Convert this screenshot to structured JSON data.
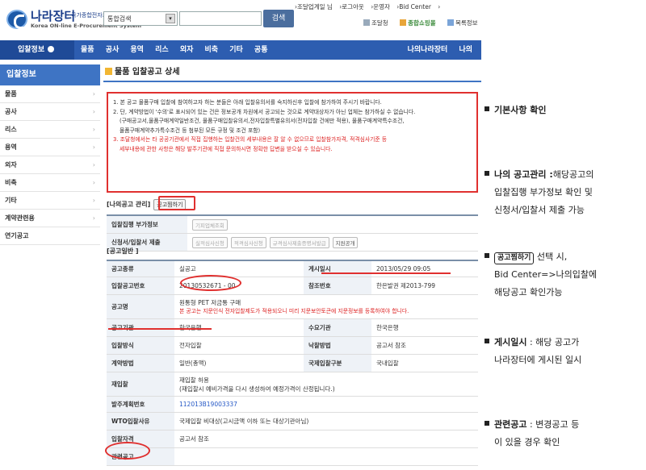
{
  "header": {
    "logo_name": "나라장터",
    "logo_sub": "국가종합전자조달",
    "logo_eng": "Korea ON-line E-Procurement System",
    "search_select": "통합검색",
    "search_button": "검색",
    "top_links": [
      "›조달업계일 님",
      "›로그아웃",
      "›운영자",
      "›Bid Center",
      "›"
    ],
    "sub_links": [
      "조달청",
      "종합쇼핑몰",
      "목록정보"
    ]
  },
  "nav": {
    "lead": "입찰정보",
    "items": [
      "물품",
      "공사",
      "용역",
      "리스",
      "외자",
      "비축",
      "기타",
      "공통"
    ],
    "right": [
      "나의나라장터",
      "나의"
    ]
  },
  "sidebar": {
    "title": "입찰정보",
    "items": [
      "물품",
      "공사",
      "리스",
      "용역",
      "외자",
      "비축",
      "기타",
      "계약관련용",
      "연기공고"
    ]
  },
  "page": {
    "title": "물품 입찰공고 상세",
    "notice": [
      "1. 본 공고 물품구매 입찰에 참여하고자 하는 분들은 아래 입찰유의서를 숙지하신후 입찰에 참가하여 주시기 바랍니다.",
      "2. 단, 계약방법이 '수의'로 표시되어 있는 건은 정보공개 차원에서 공고되는 것으로 계약대상자가 아닌 업체는 참가하실 수 없습니다.",
      "(구매공고서,물품구매계약일반조건, 물품구매입찰유의서,전자입찰특별유의서(전자입찰 건에만 적용), 물품구매계약특수조건,",
      "물품구매계약추가특수조건 등 첨부된 모든 규정 및 조건 포함)",
      "3. 조달청에서는 타 공공기관에서 직접 집행하는 입찰건의 세부내용은 잘 알 수 없으므로 입찰참가자격, 적격심사기준 등",
      "세부내용에 관한 사항은 해당 발주기관에 직접 문의하시면 정확한 답변을 받으실 수 있습니다."
    ],
    "my_section": {
      "title": "[나의공고 관리]",
      "bookmark_button": "공고찜하기",
      "rows": [
        {
          "label": "입찰집행 부가정보",
          "buttons": [
            "기피업체조회"
          ]
        },
        {
          "label": "신청서/입찰서 제출",
          "buttons": [
            "실적심사신청",
            "적격심사신청",
            "규격심사제출증명서발급",
            "지원공개"
          ]
        }
      ]
    },
    "general_section": {
      "title": "[공고일반 ]",
      "rows": [
        {
          "l1": "공고종류",
          "v1": "실공고",
          "l2": "게시일시",
          "v2": "2013/05/29 09:05"
        },
        {
          "l1": "입찰공고번호",
          "v1": "20130532671 - 00",
          "l2": "참조번호",
          "v2": "한은발권 제2013-799"
        },
        {
          "l1": "공고명",
          "v1": "원통형 PET 저금통 구매",
          "v1b": "본 공고는 지문인식 전자입찰제도가 적용되오니 미리 지문보안토큰에 지문정보를 등록하여야 합니다."
        },
        {
          "l1": "공고기관",
          "v1": "한국은행",
          "l2": "수요기관",
          "v2": "한국은행"
        },
        {
          "l1": "입찰방식",
          "v1": "전자입찰",
          "l2": "낙찰방법",
          "v2": "공고서 참조"
        },
        {
          "l1": "계약방법",
          "v1": "일반(총액)",
          "l2": "국제입찰구분",
          "v2": "국내입찰"
        },
        {
          "l1": "재입찰",
          "v1": "재입찰 허용",
          "v1b": "(재입찰시 예비가격을 다시 생성하여 예정가격이 산정됩니다.)"
        },
        {
          "l1": "발주계획번호",
          "v1": "112013B19003337"
        },
        {
          "l1": "WTO입찰사유",
          "v1": "국제입찰 비대상(고시금액 이하 또는 대상기관아님)"
        },
        {
          "l1": "입찰자격",
          "v1": "공고서 참조"
        },
        {
          "l1": "관련공고",
          "v1": ""
        }
      ]
    }
  },
  "annotations": {
    "a1_title": "기본사항 확인",
    "a2_title": "나의 공고관리 :",
    "a2_text1": "해당공고의",
    "a2_text2": "입찰집행 부가정보 확인 및",
    "a2_text3": "신청서/입찰서 제출 가능",
    "a3_tag": "공고찜하기",
    "a3_text1": "선택 시,",
    "a3_text2": "Bid Center=>나의입찰에",
    "a3_text3": "해당공고 확인가능",
    "a4_title": "게시일시",
    "a4_text1": ": 해당 공고가",
    "a4_text2": "나라장터에 게시된 일시",
    "a5_title": "관련공고",
    "a5_text1": ": 변경공고 등",
    "a5_text2": "이 있을 경우 확인"
  },
  "colors": {
    "accent": "#2d5db0",
    "highlight": "#e0302f"
  }
}
